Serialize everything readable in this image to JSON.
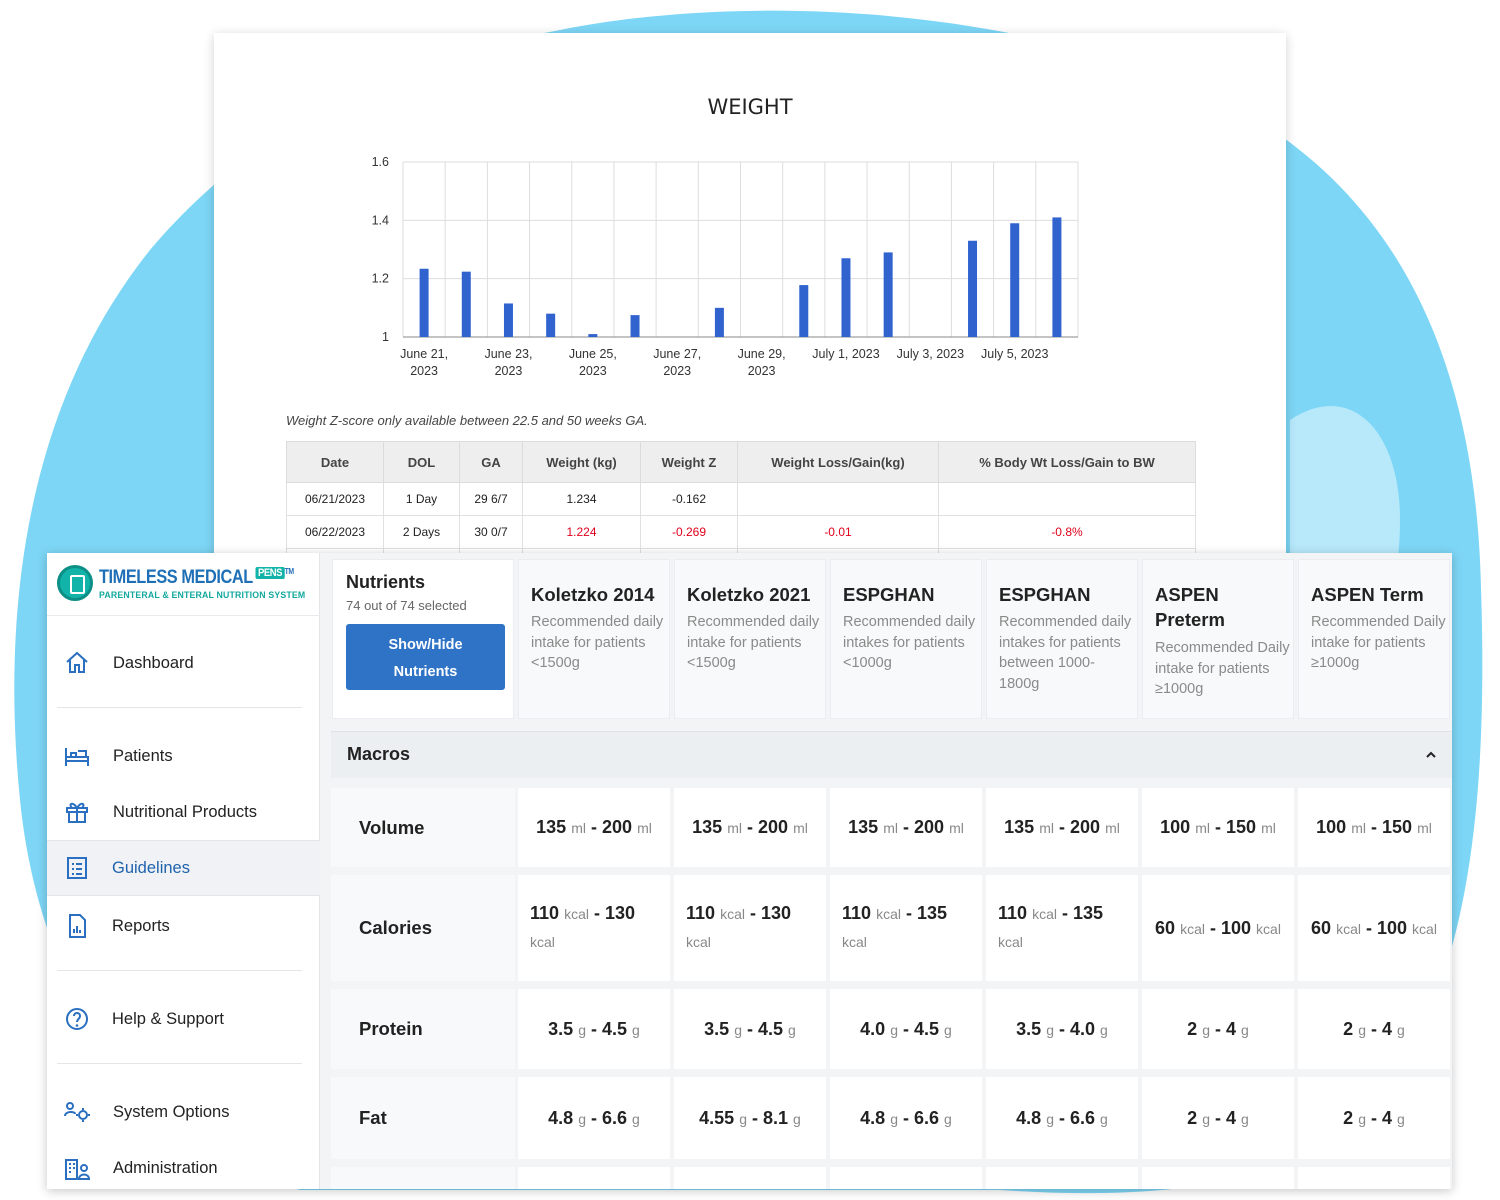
{
  "report": {
    "z_note": "Weight Z-score only available between 22.5 and 50 weeks GA.",
    "table": {
      "headers": [
        "Date",
        "DOL",
        "GA",
        "Weight (kg)",
        "Weight Z",
        "Weight Loss/Gain(kg)",
        "% Body Wt Loss/Gain to BW"
      ],
      "rows": [
        [
          "06/21/2023",
          "1 Day",
          "29 6/7",
          "1.234",
          "-0.162",
          "",
          ""
        ],
        [
          "06/22/2023",
          "2 Days",
          "30 0/7",
          "1.224",
          "-0.269",
          "-0.01",
          "-0.8%"
        ]
      ],
      "negative_color": "#e0001b"
    }
  },
  "chart_data": {
    "type": "bar",
    "title": "WEIGHT",
    "xlabel": "",
    "ylabel": "",
    "ylim": [
      1,
      1.6
    ],
    "yticks": [
      "1",
      "1.2",
      "1.4",
      "1.6"
    ],
    "grid": true,
    "bar_color": "#3163cf",
    "x_tick_labels": [
      [
        "June 21,",
        "2023"
      ],
      [
        "June 23,",
        "2023"
      ],
      [
        "June 25,",
        "2023"
      ],
      [
        "June 27,",
        "2023"
      ],
      [
        "June 29,",
        "2023"
      ],
      [
        "July 1, 2023"
      ],
      [
        "July 3, 2023"
      ],
      [
        "July 5, 2023"
      ]
    ],
    "categories": [
      "June 21, 2023",
      "June 22, 2023",
      "June 23, 2023",
      "June 24, 2023",
      "June 25, 2023",
      "June 26, 2023",
      "June 27, 2023",
      "June 28, 2023",
      "June 29, 2023",
      "June 30, 2023",
      "July 1, 2023",
      "July 2, 2023",
      "July 3, 2023",
      "July 4, 2023",
      "July 5, 2023",
      "July 6, 2023"
    ],
    "values": [
      1.234,
      1.224,
      1.115,
      1.08,
      1.01,
      1.075,
      null,
      1.1,
      null,
      1.178,
      1.27,
      1.29,
      null,
      1.33,
      1.39,
      1.41
    ]
  },
  "app": {
    "brand": {
      "name": "TIMELESS MEDICAL",
      "badge": "PENS",
      "tm": "TM",
      "sub": "PARENTERAL & ENTERAL NUTRITION SYSTEM"
    },
    "nav": {
      "dashboard": "Dashboard",
      "patients": "Patients",
      "products": "Nutritional Products",
      "guidelines": "Guidelines",
      "reports": "Reports",
      "help": "Help & Support",
      "system": "System Options",
      "admin": "Administration"
    },
    "nutrients": {
      "title": "Nutrients",
      "count": "74 out of 74 selected",
      "button": [
        "Show/Hide",
        "Nutrients"
      ]
    },
    "guidelines": [
      {
        "title": "Koletzko 2014",
        "desc": "Recommended daily intake for patients <1500g"
      },
      {
        "title": "Koletzko 2021",
        "desc": "Recommended daily intake for patients <1500g"
      },
      {
        "title": "ESPGHAN",
        "desc": "Recommended daily intakes for patients <1000g"
      },
      {
        "title": "ESPGHAN",
        "desc": "Recommended daily intakes for patients between 1000-1800g"
      },
      {
        "title": "ASPEN Preterm",
        "desc": "Recommended Daily intake for patients ≥1000g"
      },
      {
        "title": "ASPEN Term",
        "desc": "Recommended Daily intake for patients ≥1000g"
      }
    ],
    "section": {
      "title": "Macros"
    },
    "rows": [
      {
        "label": "Volume",
        "values": [
          [
            "135",
            "ml",
            "200",
            "ml"
          ],
          [
            "135",
            "ml",
            "200",
            "ml"
          ],
          [
            "135",
            "ml",
            "200",
            "ml"
          ],
          [
            "135",
            "ml",
            "200",
            "ml"
          ],
          [
            "100",
            "ml",
            "150",
            "ml"
          ],
          [
            "100",
            "ml",
            "150",
            "ml"
          ]
        ]
      },
      {
        "label": "Calories",
        "values": [
          [
            "110",
            "kcal",
            "130",
            "kcal"
          ],
          [
            "110",
            "kcal",
            "130",
            "kcal"
          ],
          [
            "110",
            "kcal",
            "135",
            "kcal"
          ],
          [
            "110",
            "kcal",
            "135",
            "kcal"
          ],
          [
            "60",
            "kcal",
            "100",
            "kcal"
          ],
          [
            "60",
            "kcal",
            "100",
            "kcal"
          ]
        ]
      },
      {
        "label": "Protein",
        "values": [
          [
            "3.5",
            "g",
            "4.5",
            "g"
          ],
          [
            "3.5",
            "g",
            "4.5",
            "g"
          ],
          [
            "4.0",
            "g",
            "4.5",
            "g"
          ],
          [
            "3.5",
            "g",
            "4.0",
            "g"
          ],
          [
            "2",
            "g",
            "4",
            "g"
          ],
          [
            "2",
            "g",
            "4",
            "g"
          ]
        ]
      },
      {
        "label": "Fat",
        "values": [
          [
            "4.8",
            "g",
            "6.6",
            "g"
          ],
          [
            "4.55",
            "g",
            "8.1",
            "g"
          ],
          [
            "4.8",
            "g",
            "6.6",
            "g"
          ],
          [
            "4.8",
            "g",
            "6.6",
            "g"
          ],
          [
            "2",
            "g",
            "4",
            "g"
          ],
          [
            "2",
            "g",
            "4",
            "g"
          ]
        ]
      }
    ]
  },
  "colors": {
    "accent": "#2f73c6",
    "blob": "#7dd6f5",
    "active_nav": "#1f63ad"
  }
}
